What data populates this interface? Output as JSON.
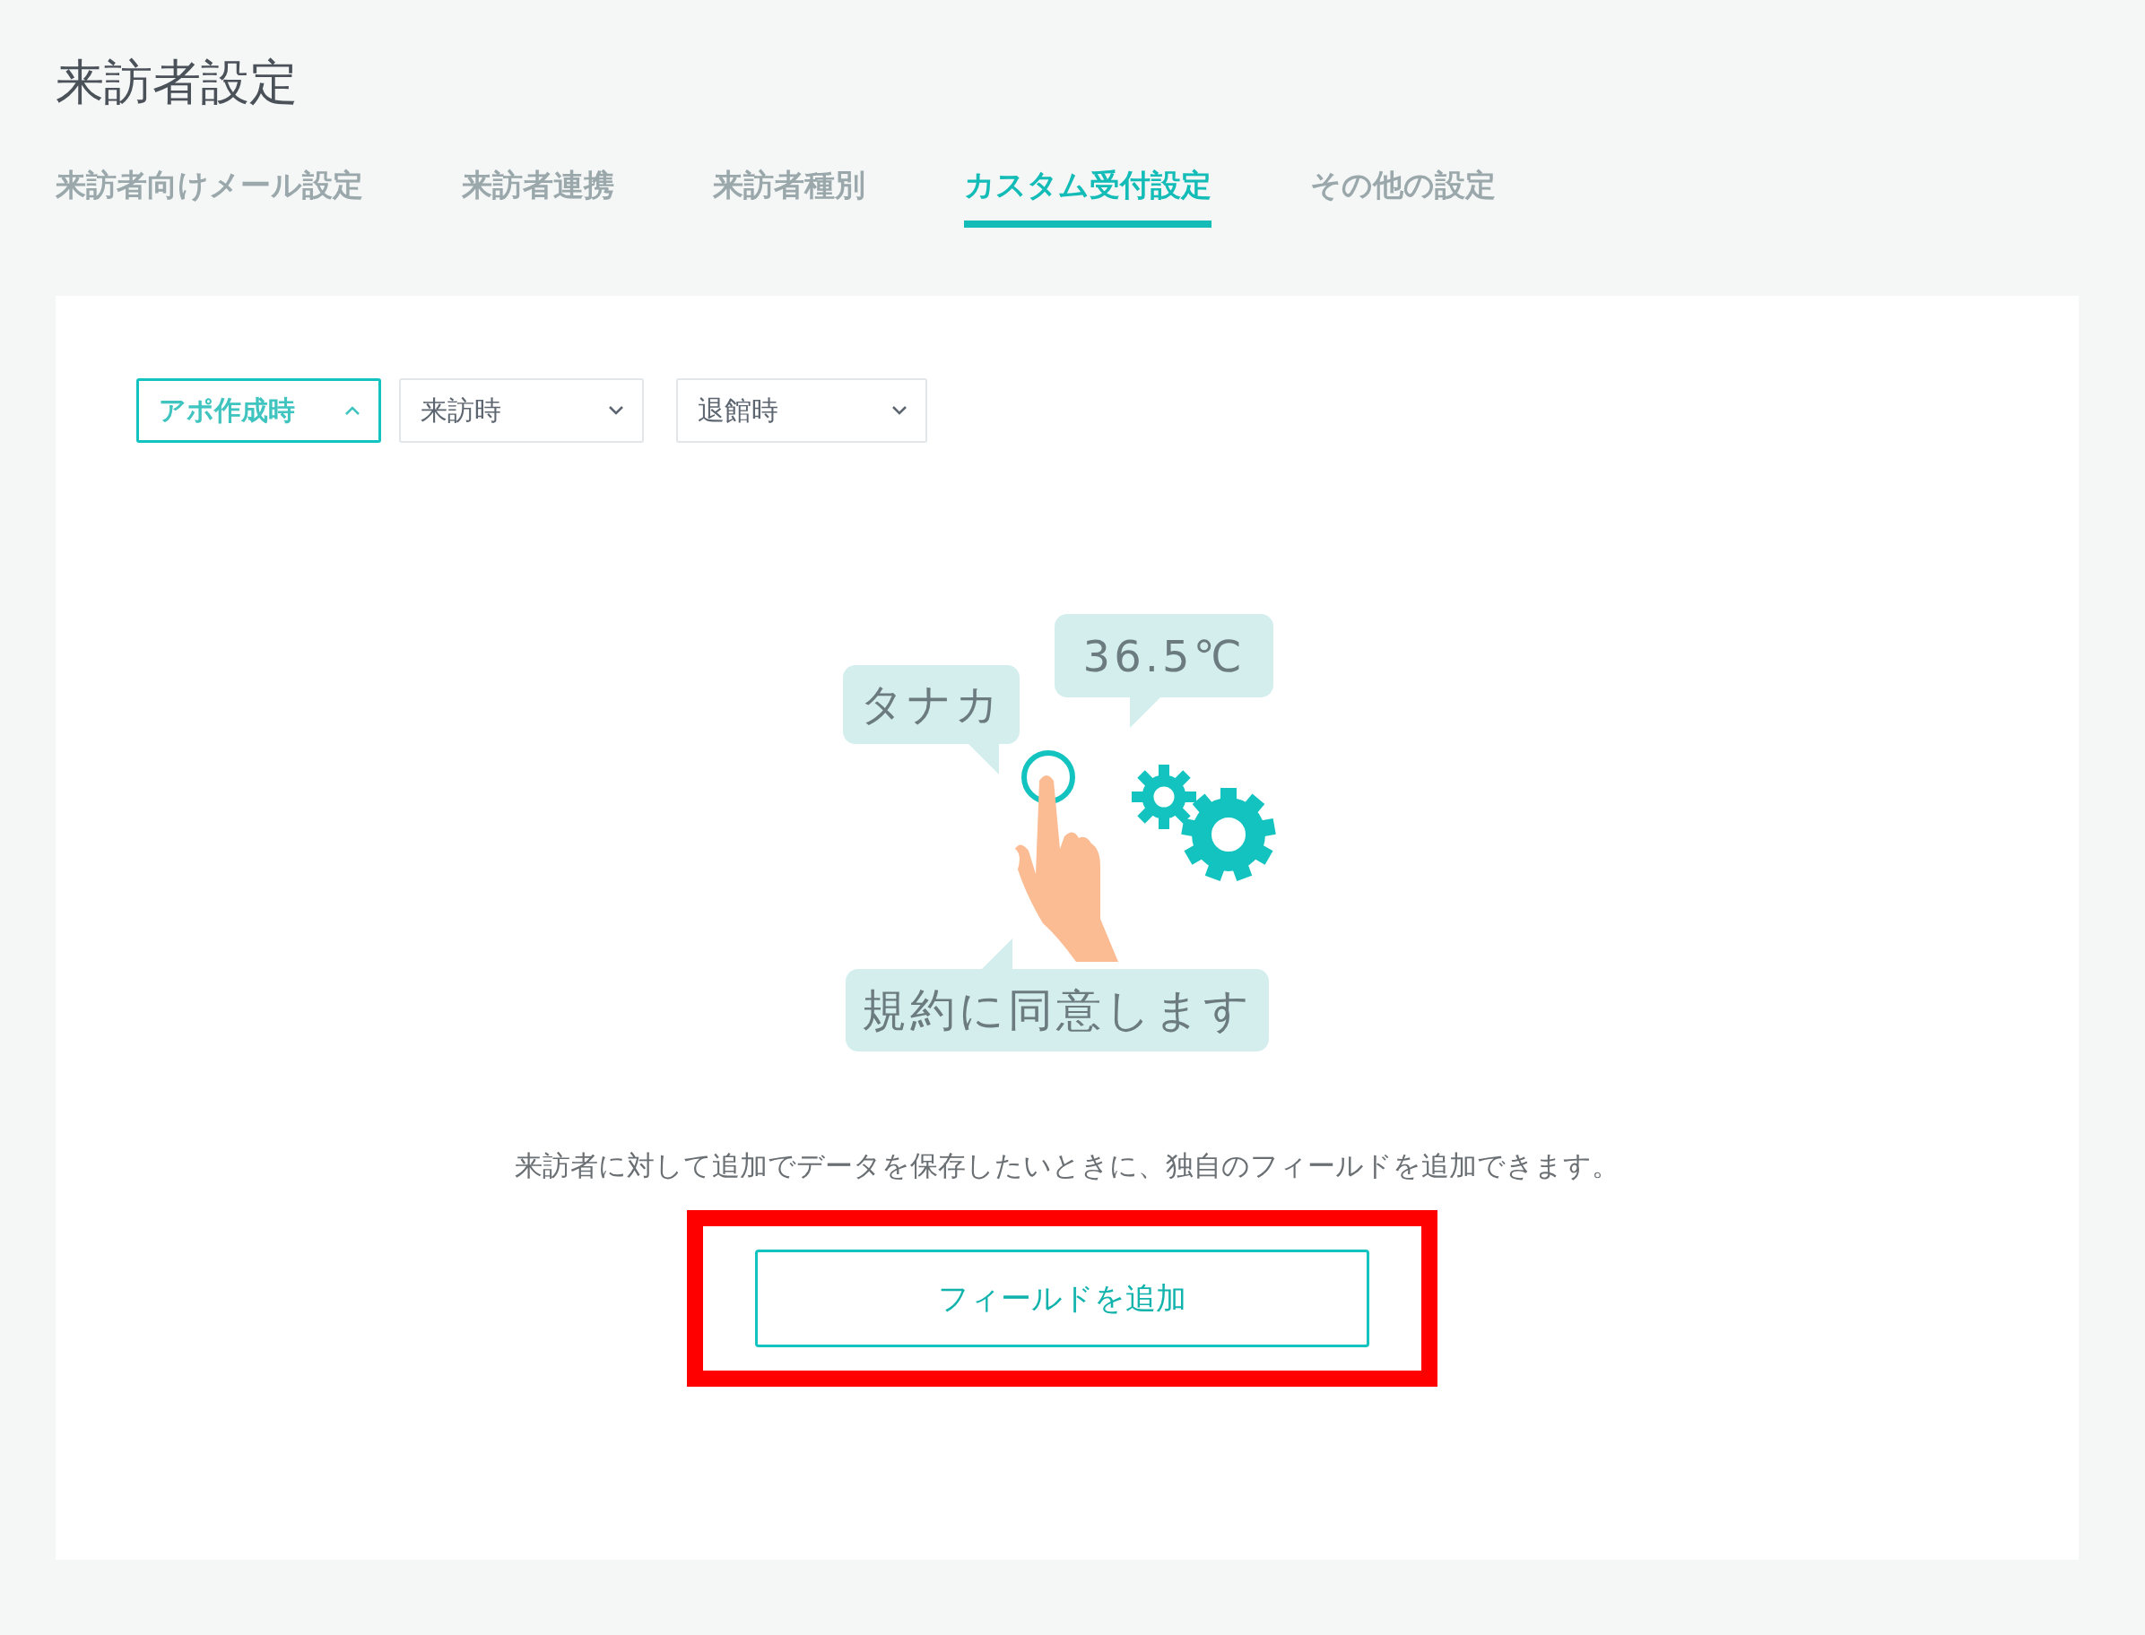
{
  "page_title": "来訪者設定",
  "tabs": [
    {
      "label": "来訪者向けメール設定",
      "selected": false
    },
    {
      "label": "来訪者連携",
      "selected": false
    },
    {
      "label": "来訪者種別",
      "selected": false
    },
    {
      "label": "カスタム受付設定",
      "selected": true
    },
    {
      "label": "その他の設定",
      "selected": false
    }
  ],
  "timing_selects": [
    {
      "label": "アポ作成時",
      "selected": true
    },
    {
      "label": "来訪時",
      "selected": false
    },
    {
      "label": "退館時",
      "selected": false
    }
  ],
  "illustration": {
    "bubbles": [
      "タナカ",
      "36.5℃",
      "規約に同意します"
    ]
  },
  "description": "来訪者に対して追加でデータを保存したいときに、独自のフィールドを追加できます。",
  "add_button": {
    "label": "フィールドを追加",
    "highlighted": true
  }
}
